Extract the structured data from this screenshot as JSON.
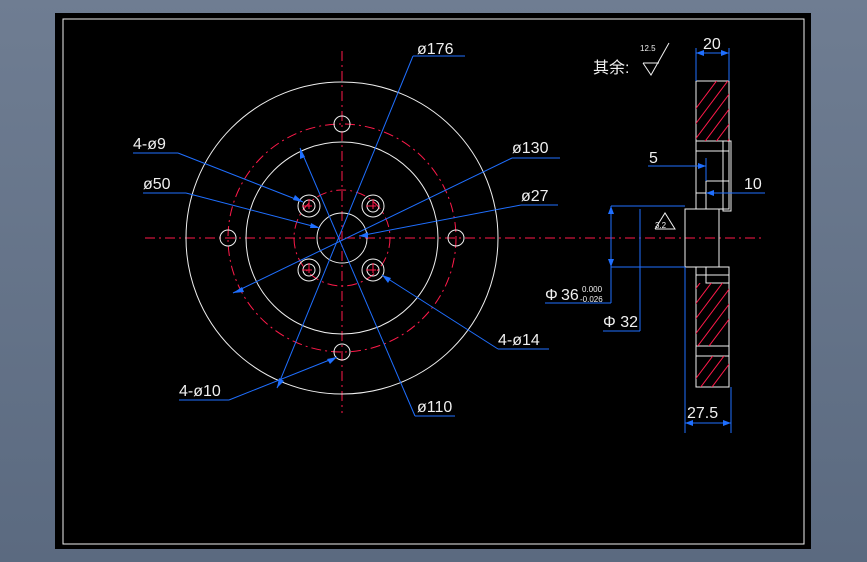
{
  "drawing": {
    "roughness_note": {
      "label": "其余:",
      "value": "12.5"
    },
    "face_view": {
      "dims": {
        "outer_diameter": "ø176",
        "bolt_circle": "ø130",
        "bore": "ø27",
        "hub": "ø50",
        "small_holes": "4-ø9",
        "large_holes": "4-ø14",
        "mount_holes": "4-ø10",
        "mid_circle": "ø110"
      }
    },
    "section_view": {
      "dims": {
        "thickness_top": "20",
        "step_5": "5",
        "step_10": "10",
        "fit_diameter_symbol": "Φ",
        "fit_diameter": "36",
        "fit_tol_upper": "0.000",
        "fit_tol_lower": "-0.026",
        "inner_diameter": "Φ 32",
        "overall_length": "27.5",
        "local_roughness": "3.2"
      }
    },
    "colors": {
      "geometry": "#f0f0f0",
      "centerline": "#ff1a4a",
      "dimension": "#1f6fff",
      "background": "#000000"
    }
  }
}
